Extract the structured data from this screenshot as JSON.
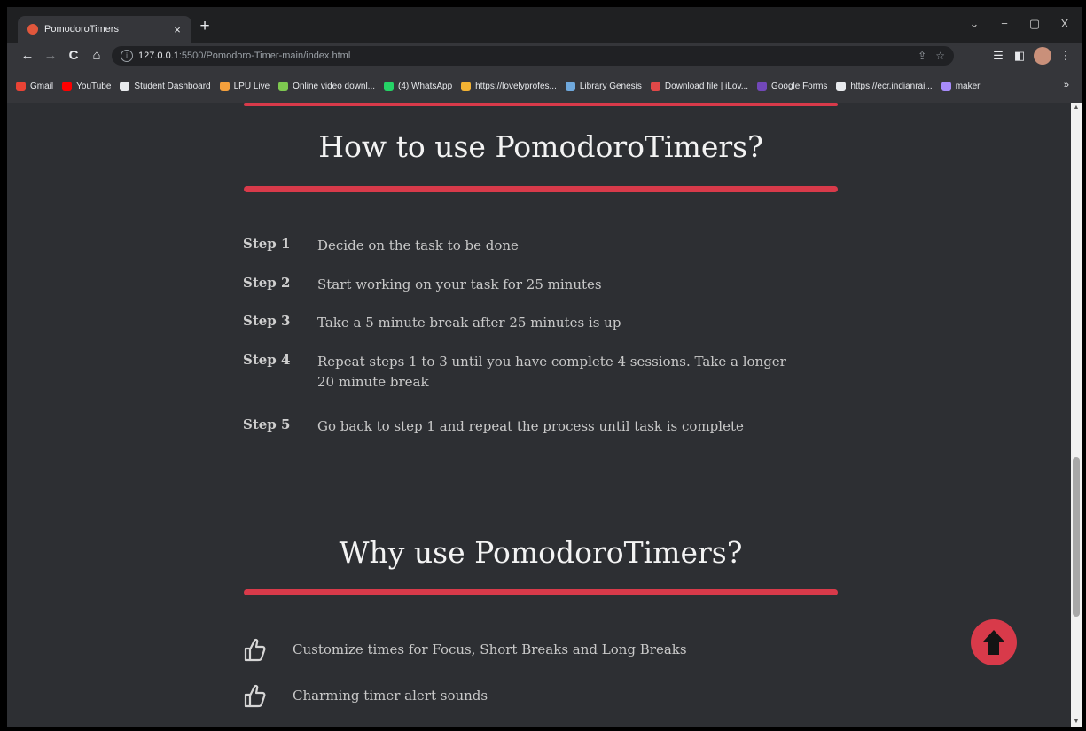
{
  "browser": {
    "tab_title": "PomodoroTimers",
    "tab_close": "×",
    "new_tab": "+",
    "window_controls": {
      "dropdown": "⌄",
      "minimize": "−",
      "restore": "▢",
      "close": "X"
    },
    "nav": {
      "back": "←",
      "forward": "→",
      "reload": "C",
      "home": "⌂"
    },
    "url_host": "127.0.0.1",
    "url_path": ":5500/Pomodoro-Timer-main/index.html",
    "bookmarks": [
      {
        "label": "Gmail",
        "color": "#ea4335"
      },
      {
        "label": "YouTube",
        "color": "#ff0000"
      },
      {
        "label": "Student Dashboard",
        "color": "#e8eaed"
      },
      {
        "label": "LPU Live",
        "color": "#f4a03c"
      },
      {
        "label": "Online video downl...",
        "color": "#7ec850"
      },
      {
        "label": "(4) WhatsApp",
        "color": "#25d366"
      },
      {
        "label": "https://lovelyprofes...",
        "color": "#f2b233"
      },
      {
        "label": "Library Genesis",
        "color": "#6fa8dc"
      },
      {
        "label": "Download file | iLov...",
        "color": "#e04848"
      },
      {
        "label": "Google Forms",
        "color": "#7248b9"
      },
      {
        "label": "https://ecr.indianrai...",
        "color": "#e8eaed"
      },
      {
        "label": "maker",
        "color": "#a78bfa"
      }
    ],
    "bookmarks_more": "»"
  },
  "how_section": {
    "title": "How to use PomodoroTimers?",
    "steps": [
      {
        "num": "Step 1",
        "text": "Decide on the task to be done"
      },
      {
        "num": "Step 2",
        "text": "Start working on your task for 25 minutes"
      },
      {
        "num": "Step 3",
        "text": "Take a 5 minute break after 25 minutes is up"
      },
      {
        "num": "Step 4",
        "text": "Repeat steps 1 to 3 until you have complete 4 sessions. Take a longer 20 minute break"
      },
      {
        "num": "Step 5",
        "text": "Go back to step 1 and repeat the process until task is complete"
      }
    ]
  },
  "why_section": {
    "title": "Why use PomodoroTimers?",
    "items": [
      {
        "text": "Customize times for Focus, Short Breaks and Long Breaks",
        "icon": "thumbs-up-icon"
      },
      {
        "text": "Charming timer alert sounds",
        "icon": "thumbs-up-icon"
      }
    ]
  },
  "colors": {
    "accent": "#d83a4a",
    "background": "#2d2f33",
    "text": "#c9c9c9"
  }
}
